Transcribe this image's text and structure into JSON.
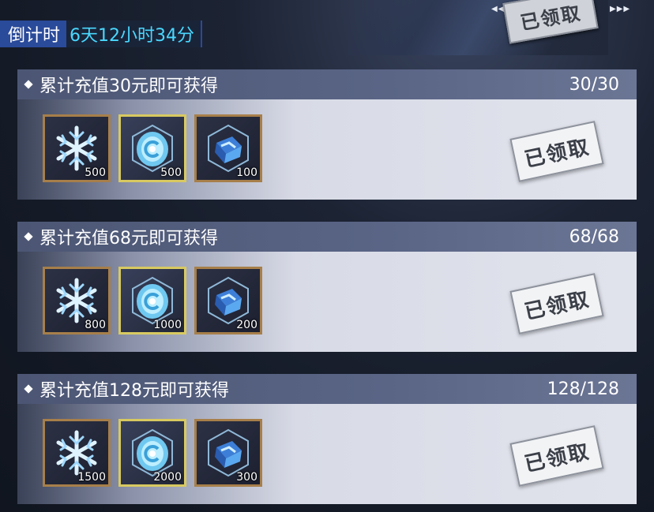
{
  "header": {
    "countdown_label": "倒计时",
    "countdown_value": "6天12小时34分",
    "claimed_stamp": "已领取"
  },
  "tiers": [
    {
      "title": "累计充值30元即可获得",
      "progress": "30/30",
      "status": "已领取",
      "rewards": [
        {
          "icon": "snowflake-icon",
          "qty": "500"
        },
        {
          "icon": "crystal-icon",
          "qty": "500"
        },
        {
          "icon": "cube-crystal-icon",
          "qty": "100"
        }
      ]
    },
    {
      "title": "累计充值68元即可获得",
      "progress": "68/68",
      "status": "已领取",
      "rewards": [
        {
          "icon": "snowflake-icon",
          "qty": "800"
        },
        {
          "icon": "crystal-icon",
          "qty": "1000"
        },
        {
          "icon": "cube-crystal-icon",
          "qty": "200"
        }
      ]
    },
    {
      "title": "累计充值128元即可获得",
      "progress": "128/128",
      "status": "已领取",
      "rewards": [
        {
          "icon": "snowflake-icon",
          "qty": "1500"
        },
        {
          "icon": "crystal-icon",
          "qty": "2000"
        },
        {
          "icon": "cube-crystal-icon",
          "qty": "300"
        }
      ]
    }
  ]
}
